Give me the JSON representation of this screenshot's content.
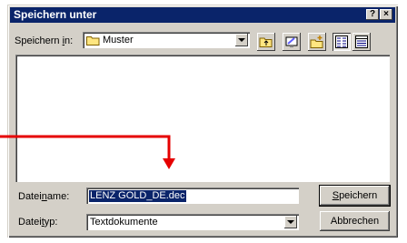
{
  "window": {
    "title": "Speichern unter",
    "help_label": "?",
    "close_label": "×"
  },
  "location": {
    "label_pre": "Speichern ",
    "label_key": "i",
    "label_post": "n:",
    "folder": "Muster"
  },
  "toolbar": {
    "icons": [
      "folder-up-icon",
      "desktop-icon",
      "new-folder-icon",
      "list-view-icon",
      "details-view-icon"
    ]
  },
  "filename": {
    "label_pre": "Datei",
    "label_key": "n",
    "label_post": "ame:",
    "value": "LENZ GOLD_DE.dec"
  },
  "filetype": {
    "label_pre": "Datei",
    "label_key": "t",
    "label_post": "yp:",
    "value": "Textdokumente"
  },
  "buttons": {
    "save_key": "S",
    "save_rest": "peichern",
    "cancel": "Abbrechen"
  },
  "annotation": {
    "arrow_color": "#e60000"
  }
}
